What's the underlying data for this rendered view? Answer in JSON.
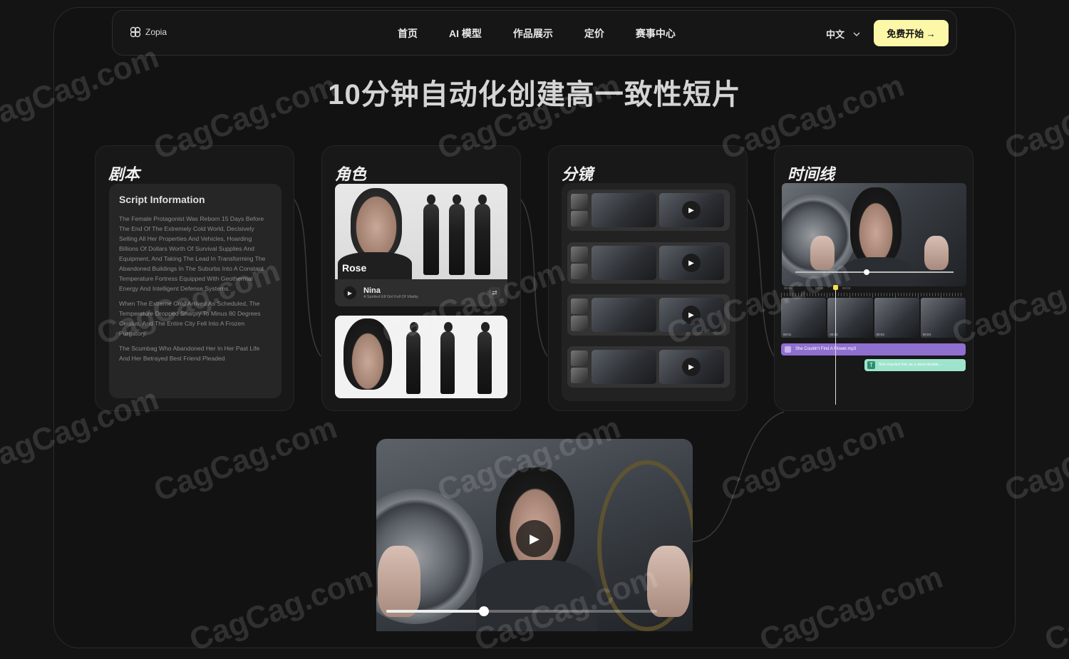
{
  "nav": {
    "brand": "Zopia",
    "links": [
      "首页",
      "AI 模型",
      "作品展示",
      "定价",
      "赛事中心"
    ],
    "language": "中文",
    "cta": "免费开始 →"
  },
  "headline": "10分钟自动化创建高一致性短片",
  "script_card": {
    "title": "剧本",
    "heading": "Script Information",
    "paragraphs": [
      "The Female Protagonist Was Reborn 15 Days Before The End Of The Extremely Cold World, Decisively Selling All Her Properties And Vehicles, Hoarding Billions Of Dollars Worth Of Survival Supplies And Equipment, And Taking The Lead In Transforming The Abandoned Buildings In The Suburbs Into A Constant Temperature Fortress Equipped With Geothermal Energy And Intelligent Defense Systems.",
      "When The Extreme Cold Arrived As Scheduled, The Temperature Dropped Sharply To Minus 80 Degrees Celsius, And The Entire City Fell Into A Frozen Purgatory.",
      "The Scumbag Who Abandoned Her In Her Past Life And Her Betrayed Best Friend Pleaded"
    ]
  },
  "character_card": {
    "title": "角色",
    "character1_name": "Rose",
    "voice_name": "Nina",
    "voice_desc": "A Spirited Elf Girl Full Of Vitality"
  },
  "storyboard_card": {
    "title": "分镜",
    "rows": 4
  },
  "timeline_card": {
    "title": "时间线",
    "ruler_labels": [
      "00:01",
      "00:02",
      "00:03"
    ],
    "clip_labels": [
      "00:01",
      "00:02",
      "00:03",
      "00:04"
    ],
    "audio_clip": "She Couldn't Find A Flower.mp3",
    "text_clip": "She married him as a stunt double...",
    "text_icon": "T",
    "preview_progress": 0.45
  },
  "player": {
    "progress": 0.36
  },
  "watermark": "CagCag.com",
  "colors": {
    "accent_yellow": "#fdf8a8",
    "audio_purple": "#8f6fd0",
    "text_green": "#9ee4cc"
  }
}
